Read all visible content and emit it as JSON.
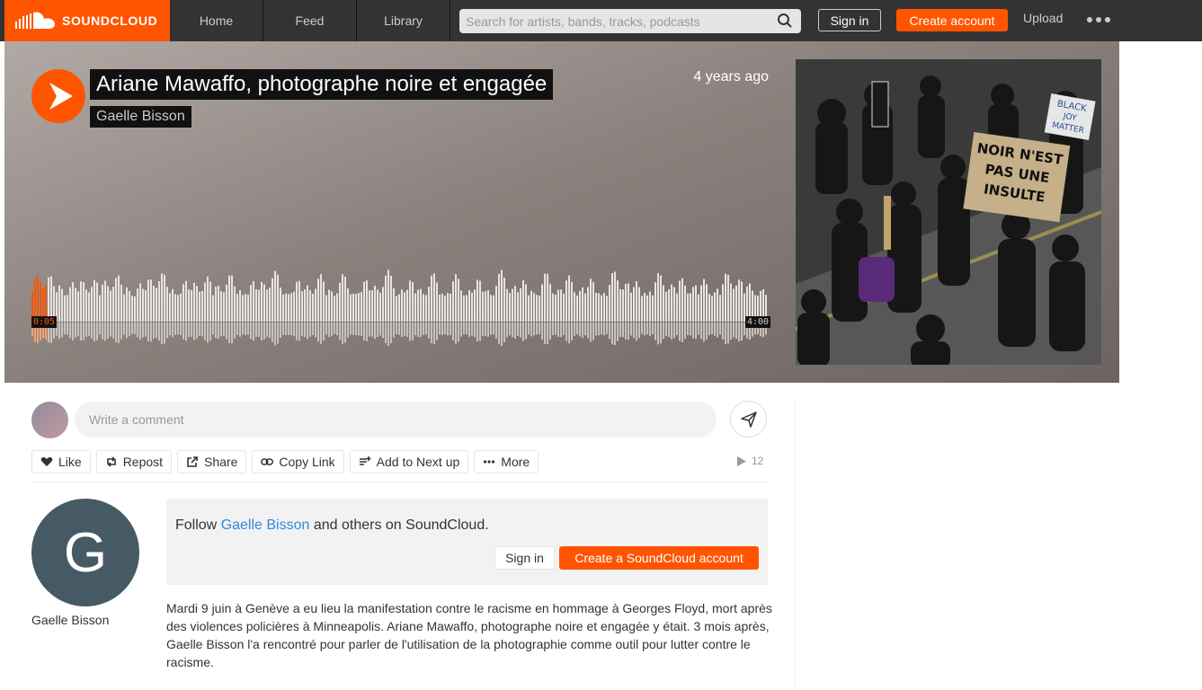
{
  "header": {
    "logo_text": "SOUNDCLOUD",
    "nav": [
      "Home",
      "Feed",
      "Library"
    ],
    "search_placeholder": "Search for artists, bands, tracks, podcasts",
    "sign_in": "Sign in",
    "create_account": "Create account",
    "upload": "Upload"
  },
  "track": {
    "title": "Ariane Mawaffo, photographe noire et engagée",
    "artist": "Gaelle Bisson",
    "posted": "4 years ago",
    "current_time": "0:05",
    "duration": "4:00",
    "progress_fraction": 0.021,
    "cover_sign_text": [
      "NOIR N'EST",
      "PAS UNE",
      "INSULTE"
    ],
    "cover_small_sign": [
      "BLACK",
      "JOY",
      "MATTER"
    ]
  },
  "comment": {
    "placeholder": "Write a comment"
  },
  "actions": {
    "like": "Like",
    "repost": "Repost",
    "share": "Share",
    "copy_link": "Copy Link",
    "add_next": "Add to Next up",
    "more": "More",
    "play_count": "12"
  },
  "user": {
    "initial": "G",
    "name": "Gaelle Bisson"
  },
  "follow_box": {
    "prefix": "Follow ",
    "user_link": "Gaelle Bisson",
    "suffix": " and others on SoundCloud.",
    "sign_in": "Sign in",
    "create": "Create a SoundCloud account"
  },
  "description": "Mardi 9 juin à Genève a eu lieu la manifestation contre le racisme en hommage à Georges Floyd, mort après des violences policières à Minneapolis. Ariane Mawaffo, photographe noire et engagée y était. 3 mois après, Gaelle Bisson l'a rencontré pour parler de l'utilisation de la photographie comme outil pour lutter contre le racisme.",
  "colors": {
    "brand": "#ff5500",
    "topbar": "#333333",
    "link": "#3388dd"
  }
}
